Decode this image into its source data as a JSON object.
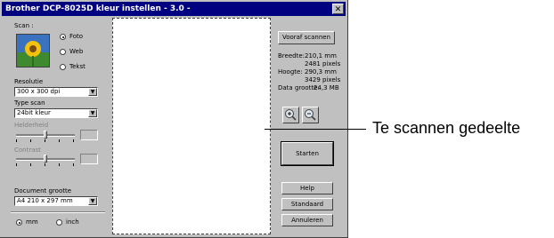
{
  "window": {
    "title": "Brother DCP-8025D kleur instellen - 3.0 -",
    "close_glyph": "✕"
  },
  "scan": {
    "label": "Scan :",
    "options": [
      {
        "label": "Foto",
        "selected": true
      },
      {
        "label": "Web",
        "selected": false
      },
      {
        "label": "Tekst",
        "selected": false
      }
    ]
  },
  "resolution": {
    "label": "Resolutie",
    "value": "300 x 300 dpi"
  },
  "scan_type": {
    "label": "Type scan",
    "value": "24bit kleur"
  },
  "brightness": {
    "label": "Helderheid"
  },
  "contrast": {
    "label": "Contrast"
  },
  "document_size": {
    "label": "Document grootte",
    "value": "A4 210 x 297 mm"
  },
  "units": [
    {
      "label": "mm",
      "selected": true
    },
    {
      "label": "inch",
      "selected": false
    }
  ],
  "buttons": {
    "prescan": "Vooraf scannen",
    "start": "Starten",
    "help": "Help",
    "default": "Standaard",
    "cancel": "Annuleren"
  },
  "info": {
    "width_label": "Breedte:",
    "width_mm": "210,1 mm",
    "width_px": "2481 pixels",
    "height_label": "Hoogte:",
    "height_mm": "290,3 mm",
    "height_px": "3429 pixels",
    "datasize_label": "Data grootte:",
    "datasize_value": "24,3 MB"
  },
  "callout": {
    "text": "Te scannen gedeelte"
  },
  "colors": {
    "titlebar": "#000080",
    "face": "#c0c0c0"
  },
  "icons": [
    "zoom-in-icon",
    "zoom-out-icon",
    "close-icon",
    "dropdown-arrow-icon"
  ]
}
